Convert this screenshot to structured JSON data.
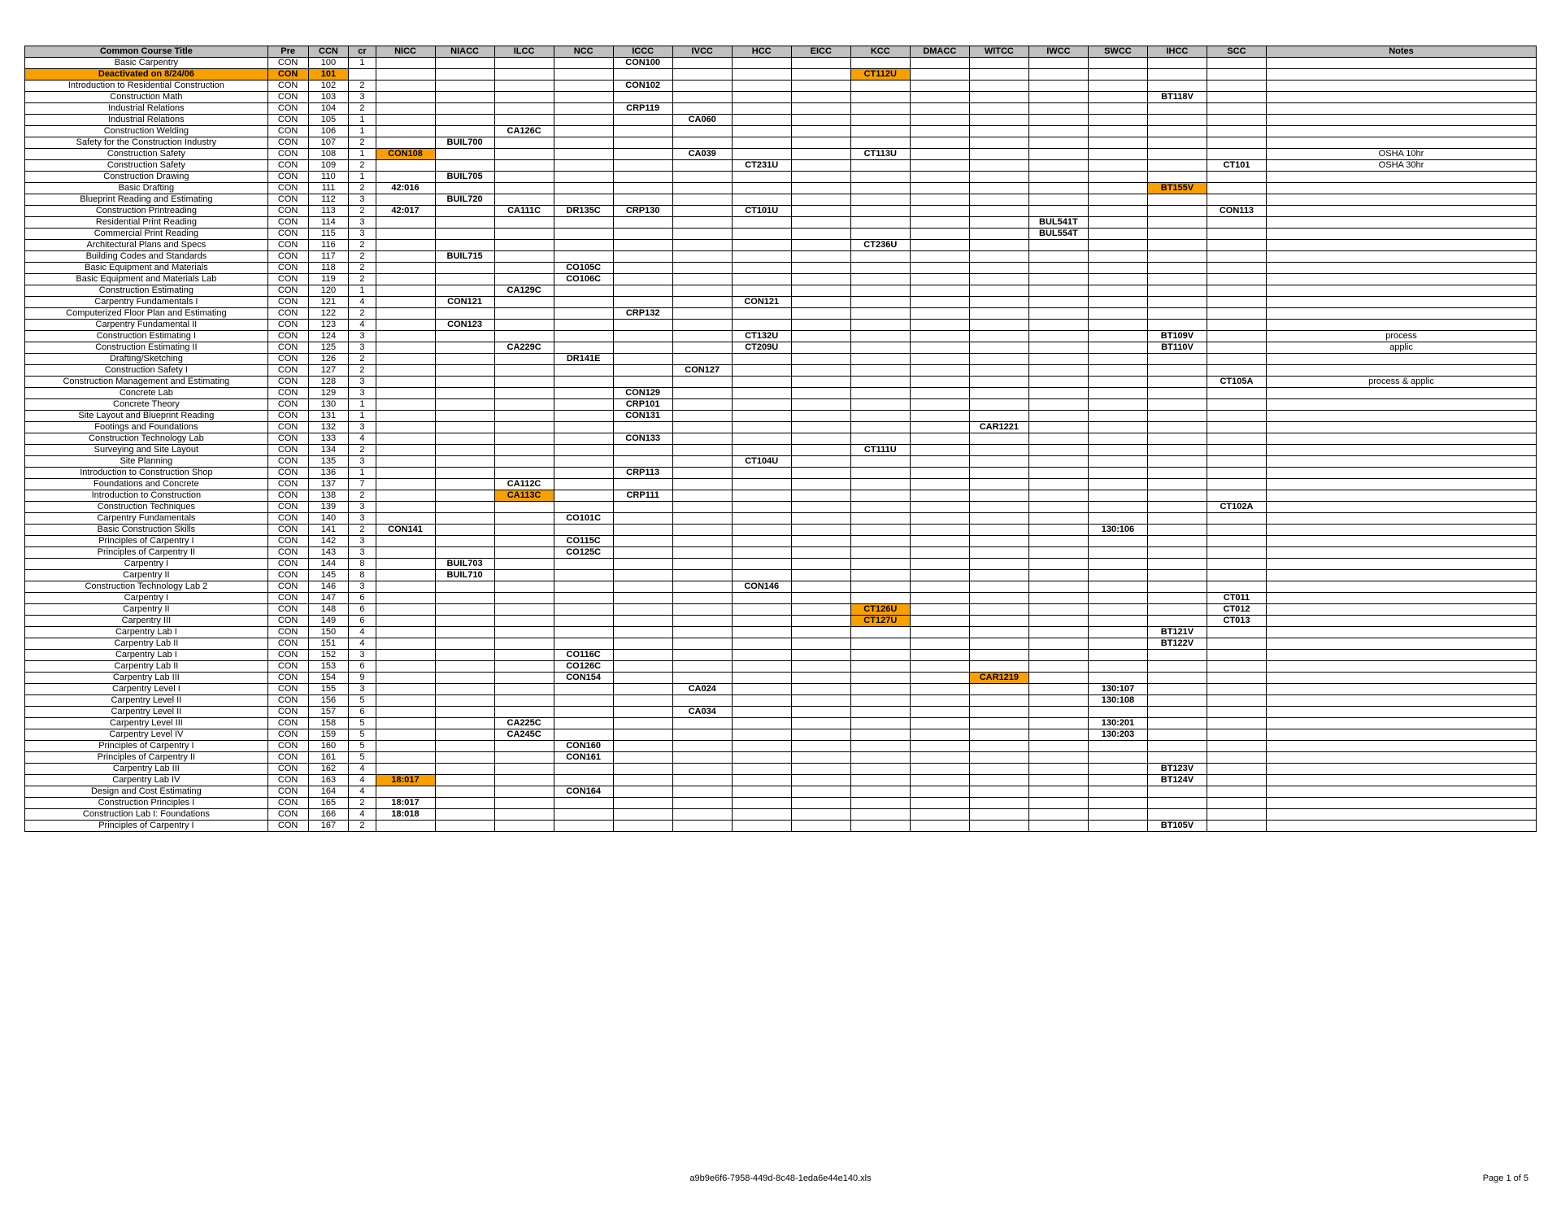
{
  "footer": {
    "filename": "a9b9e6f6-7958-449d-8c48-1eda6e44e140.xls",
    "page": "Page 1 of 5"
  },
  "columns": [
    "Common Course Title",
    "Pre",
    "CCN",
    "cr",
    "NICC",
    "NIACC",
    "ILCC",
    "NCC",
    "ICCC",
    "IVCC",
    "HCC",
    "EICC",
    "KCC",
    "DMACC",
    "WITCC",
    "IWCC",
    "SWCC",
    "IHCC",
    "SCC",
    "Notes"
  ],
  "colKeys": [
    "title",
    "pre",
    "ccn",
    "cr",
    "NICC",
    "NIACC",
    "ILCC",
    "NCC",
    "ICCC",
    "IVCC",
    "HCC",
    "EICC",
    "KCC",
    "DMACC",
    "WITCC",
    "IWCC",
    "SWCC",
    "IHCC",
    "SCC",
    "notes"
  ],
  "highlightRows": [
    1
  ],
  "highlightCells": {
    "0": {},
    "1": {
      "KCC": true
    },
    "8": {
      "NICC": true
    },
    "11": {
      "IHCC": true
    },
    "38": {
      "ILCC": true
    },
    "48": {
      "KCC": true
    },
    "49": {
      "KCC": true
    },
    "54": {
      "WITCC": true
    },
    "63": {
      "NICC": true
    }
  },
  "rows": [
    {
      "title": "Basic Carpentry",
      "pre": "CON",
      "ccn": "100",
      "cr": "1",
      "ICCC": "CON100"
    },
    {
      "title": "Deactivated on 8/24/06",
      "pre": "CON",
      "ccn": "101",
      "KCC": "CT112U"
    },
    {
      "title": "Introduction to Residential Construction",
      "pre": "CON",
      "ccn": "102",
      "cr": "2",
      "ICCC": "CON102"
    },
    {
      "title": "Construction Math",
      "pre": "CON",
      "ccn": "103",
      "cr": "3",
      "IHCC": "BT118V"
    },
    {
      "title": "Industrial Relations",
      "pre": "CON",
      "ccn": "104",
      "cr": "2",
      "ICCC": "CRP119"
    },
    {
      "title": "Industrial Relations",
      "pre": "CON",
      "ccn": "105",
      "cr": "1",
      "IVCC": "CA060"
    },
    {
      "title": "Construction Welding",
      "pre": "CON",
      "ccn": "106",
      "cr": "1",
      "ILCC": "CA126C"
    },
    {
      "title": "Safety for the Construction Industry",
      "pre": "CON",
      "ccn": "107",
      "cr": "2",
      "NIACC": "BUIL700"
    },
    {
      "title": "Construction Safety",
      "pre": "CON",
      "ccn": "108",
      "cr": "1",
      "NICC": "CON108",
      "IVCC": "CA039",
      "KCC": "CT113U",
      "notes": "OSHA 10hr"
    },
    {
      "title": "Construction Safety",
      "pre": "CON",
      "ccn": "109",
      "cr": "2",
      "HCC": "CT231U",
      "SCC": "CT101",
      "notes": "OSHA 30hr"
    },
    {
      "title": "Construction Drawing",
      "pre": "CON",
      "ccn": "110",
      "cr": "1",
      "NIACC": "BUIL705"
    },
    {
      "title": "Basic Drafting",
      "pre": "CON",
      "ccn": "111",
      "cr": "2",
      "NICC": "42:016",
      "IHCC": "BT155V"
    },
    {
      "title": "Blueprint Reading and Estimating",
      "pre": "CON",
      "ccn": "112",
      "cr": "3",
      "NIACC": "BUIL720"
    },
    {
      "title": "Construction Printreading",
      "pre": "CON",
      "ccn": "113",
      "cr": "2",
      "NICC": "42:017",
      "ILCC": "CA111C",
      "NCC": "DR135C",
      "ICCC": "CRP130",
      "HCC": "CT101U",
      "SCC": "CON113"
    },
    {
      "title": "Residential Print Reading",
      "pre": "CON",
      "ccn": "114",
      "cr": "3",
      "IWCC": "BUL541T"
    },
    {
      "title": "Commercial Print Reading",
      "pre": "CON",
      "ccn": "115",
      "cr": "3",
      "IWCC": "BUL554T"
    },
    {
      "title": "Architectural Plans and Specs",
      "pre": "CON",
      "ccn": "116",
      "cr": "2",
      "KCC": "CT236U"
    },
    {
      "title": "Building Codes and Standards",
      "pre": "CON",
      "ccn": "117",
      "cr": "2",
      "NIACC": "BUIL715"
    },
    {
      "title": "Basic Equipment and Materials",
      "pre": "CON",
      "ccn": "118",
      "cr": "2",
      "NCC": "CO105C"
    },
    {
      "title": "Basic Equipment and Materials Lab",
      "pre": "CON",
      "ccn": "119",
      "cr": "2",
      "NCC": "CO106C"
    },
    {
      "title": "Construction Estimating",
      "pre": "CON",
      "ccn": "120",
      "cr": "1",
      "ILCC": "CA129C"
    },
    {
      "title": "Carpentry Fundamentals I",
      "pre": "CON",
      "ccn": "121",
      "cr": "4",
      "NIACC": "CON121",
      "HCC": "CON121"
    },
    {
      "title": "Computerized Floor Plan and Estimating",
      "pre": "CON",
      "ccn": "122",
      "cr": "2",
      "ICCC": "CRP132"
    },
    {
      "title": "Carpentry Fundamental II",
      "pre": "CON",
      "ccn": "123",
      "cr": "4",
      "NIACC": "CON123"
    },
    {
      "title": "Construction Estimating I",
      "pre": "CON",
      "ccn": "124",
      "cr": "3",
      "HCC": "CT132U",
      "IHCC": "BT109V",
      "notes": "process"
    },
    {
      "title": "Construction Estimating II",
      "pre": "CON",
      "ccn": "125",
      "cr": "3",
      "ILCC": "CA229C",
      "HCC": "CT209U",
      "IHCC": "BT110V",
      "notes": "applic"
    },
    {
      "title": "Drafting/Sketching",
      "pre": "CON",
      "ccn": "126",
      "cr": "2",
      "NCC": "DR141E"
    },
    {
      "title": "Construction Safety I",
      "pre": "CON",
      "ccn": "127",
      "cr": "2",
      "IVCC": "CON127"
    },
    {
      "title": "Construction Management and Estimating",
      "pre": "CON",
      "ccn": "128",
      "cr": "3",
      "SCC": "CT105A",
      "notes": "process & applic"
    },
    {
      "title": "Concrete Lab",
      "pre": "CON",
      "ccn": "129",
      "cr": "3",
      "ICCC": "CON129"
    },
    {
      "title": "Concrete Theory",
      "pre": "CON",
      "ccn": "130",
      "cr": "1",
      "ICCC": "CRP101"
    },
    {
      "title": "Site Layout and Blueprint Reading",
      "pre": "CON",
      "ccn": "131",
      "cr": "1",
      "ICCC": "CON131"
    },
    {
      "title": "Footings and Foundations",
      "pre": "CON",
      "ccn": "132",
      "cr": "3",
      "WITCC": "CAR1221"
    },
    {
      "title": "Construction Technology Lab",
      "pre": "CON",
      "ccn": "133",
      "cr": "4",
      "ICCC": "CON133"
    },
    {
      "title": "Surveying and Site Layout",
      "pre": "CON",
      "ccn": "134",
      "cr": "2",
      "KCC": "CT111U"
    },
    {
      "title": "Site Planning",
      "pre": "CON",
      "ccn": "135",
      "cr": "3",
      "HCC": "CT104U"
    },
    {
      "title": "Introduction to Construction Shop",
      "pre": "CON",
      "ccn": "136",
      "cr": "1",
      "ICCC": "CRP113"
    },
    {
      "title": "Foundations and Concrete",
      "pre": "CON",
      "ccn": "137",
      "cr": "7",
      "ILCC": "CA112C"
    },
    {
      "title": "Introduction to Construction",
      "pre": "CON",
      "ccn": "138",
      "cr": "2",
      "ILCC": "CA113C",
      "ICCC": "CRP111"
    },
    {
      "title": "Construction Techniques",
      "pre": "CON",
      "ccn": "139",
      "cr": "3",
      "SCC": "CT102A"
    },
    {
      "title": "Carpentry Fundamentals",
      "pre": "CON",
      "ccn": "140",
      "cr": "3",
      "NCC": "CO101C"
    },
    {
      "title": "Basic Construction Skills",
      "pre": "CON",
      "ccn": "141",
      "cr": "2",
      "NICC": "CON141",
      "SWCC": "130:106"
    },
    {
      "title": "Principles of Carpentry I",
      "pre": "CON",
      "ccn": "142",
      "cr": "3",
      "NCC": "CO115C"
    },
    {
      "title": "Principles of Carpentry II",
      "pre": "CON",
      "ccn": "143",
      "cr": "3",
      "NCC": "CO125C"
    },
    {
      "title": "Carpentry I",
      "pre": "CON",
      "ccn": "144",
      "cr": "8",
      "NIACC": "BUIL703"
    },
    {
      "title": "Carpentry II",
      "pre": "CON",
      "ccn": "145",
      "cr": "8",
      "NIACC": "BUIL710"
    },
    {
      "title": "Construction Technology Lab 2",
      "pre": "CON",
      "ccn": "146",
      "cr": "3",
      "HCC": "CON146"
    },
    {
      "title": "Carpentry I",
      "pre": "CON",
      "ccn": "147",
      "cr": "6",
      "SCC": "CT011"
    },
    {
      "title": "Carpentry II",
      "pre": "CON",
      "ccn": "148",
      "cr": "6",
      "KCC": "CT126U",
      "SCC": "CT012"
    },
    {
      "title": "Carpentry III",
      "pre": "CON",
      "ccn": "149",
      "cr": "6",
      "KCC": "CT127U",
      "SCC": "CT013"
    },
    {
      "title": "Carpentry Lab I",
      "pre": "CON",
      "ccn": "150",
      "cr": "4",
      "IHCC": "BT121V"
    },
    {
      "title": "Carpentry Lab II",
      "pre": "CON",
      "ccn": "151",
      "cr": "4",
      "IHCC": "BT122V"
    },
    {
      "title": "Carpentry Lab I",
      "pre": "CON",
      "ccn": "152",
      "cr": "3",
      "NCC": "CO116C"
    },
    {
      "title": "Carpentry Lab II",
      "pre": "CON",
      "ccn": "153",
      "cr": "6",
      "NCC": "CO126C"
    },
    {
      "title": "Carpentry Lab III",
      "pre": "CON",
      "ccn": "154",
      "cr": "9",
      "NCC": "CON154",
      "WITCC": "CAR1219"
    },
    {
      "title": "Carpentry Level I",
      "pre": "CON",
      "ccn": "155",
      "cr": "3",
      "IVCC": "CA024",
      "SWCC": "130:107"
    },
    {
      "title": "Carpentry Level II",
      "pre": "CON",
      "ccn": "156",
      "cr": "5",
      "SWCC": "130:108"
    },
    {
      "title": "Carpentry Level II",
      "pre": "CON",
      "ccn": "157",
      "cr": "6",
      "IVCC": "CA034"
    },
    {
      "title": "Carpentry Level III",
      "pre": "CON",
      "ccn": "158",
      "cr": "5",
      "ILCC": "CA225C",
      "SWCC": "130:201"
    },
    {
      "title": "Carpentry Level IV",
      "pre": "CON",
      "ccn": "159",
      "cr": "5",
      "ILCC": "CA245C",
      "SWCC": "130:203"
    },
    {
      "title": "Principles of Carpentry I",
      "pre": "CON",
      "ccn": "160",
      "cr": "5",
      "NCC": "CON160"
    },
    {
      "title": "Principles of Carpentry II",
      "pre": "CON",
      "ccn": "161",
      "cr": "5",
      "NCC": "CON161"
    },
    {
      "title": "Carpentry Lab III",
      "pre": "CON",
      "ccn": "162",
      "cr": "4",
      "IHCC": "BT123V"
    },
    {
      "title": "Carpentry Lab IV",
      "pre": "CON",
      "ccn": "163",
      "cr": "4",
      "NICC": "18:017",
      "IHCC": "BT124V"
    },
    {
      "title": "Design and Cost Estimating",
      "pre": "CON",
      "ccn": "164",
      "cr": "4",
      "NCC": "CON164"
    },
    {
      "title": "Construction Principles I",
      "pre": "CON",
      "ccn": "165",
      "cr": "2",
      "NICC": "18:017"
    },
    {
      "title": "Construction Lab I: Foundations",
      "pre": "CON",
      "ccn": "166",
      "cr": "4",
      "NICC": "18:018"
    },
    {
      "title": "Principles of Carpentry I",
      "pre": "CON",
      "ccn": "167",
      "cr": "2",
      "IHCC": "BT105V"
    }
  ]
}
